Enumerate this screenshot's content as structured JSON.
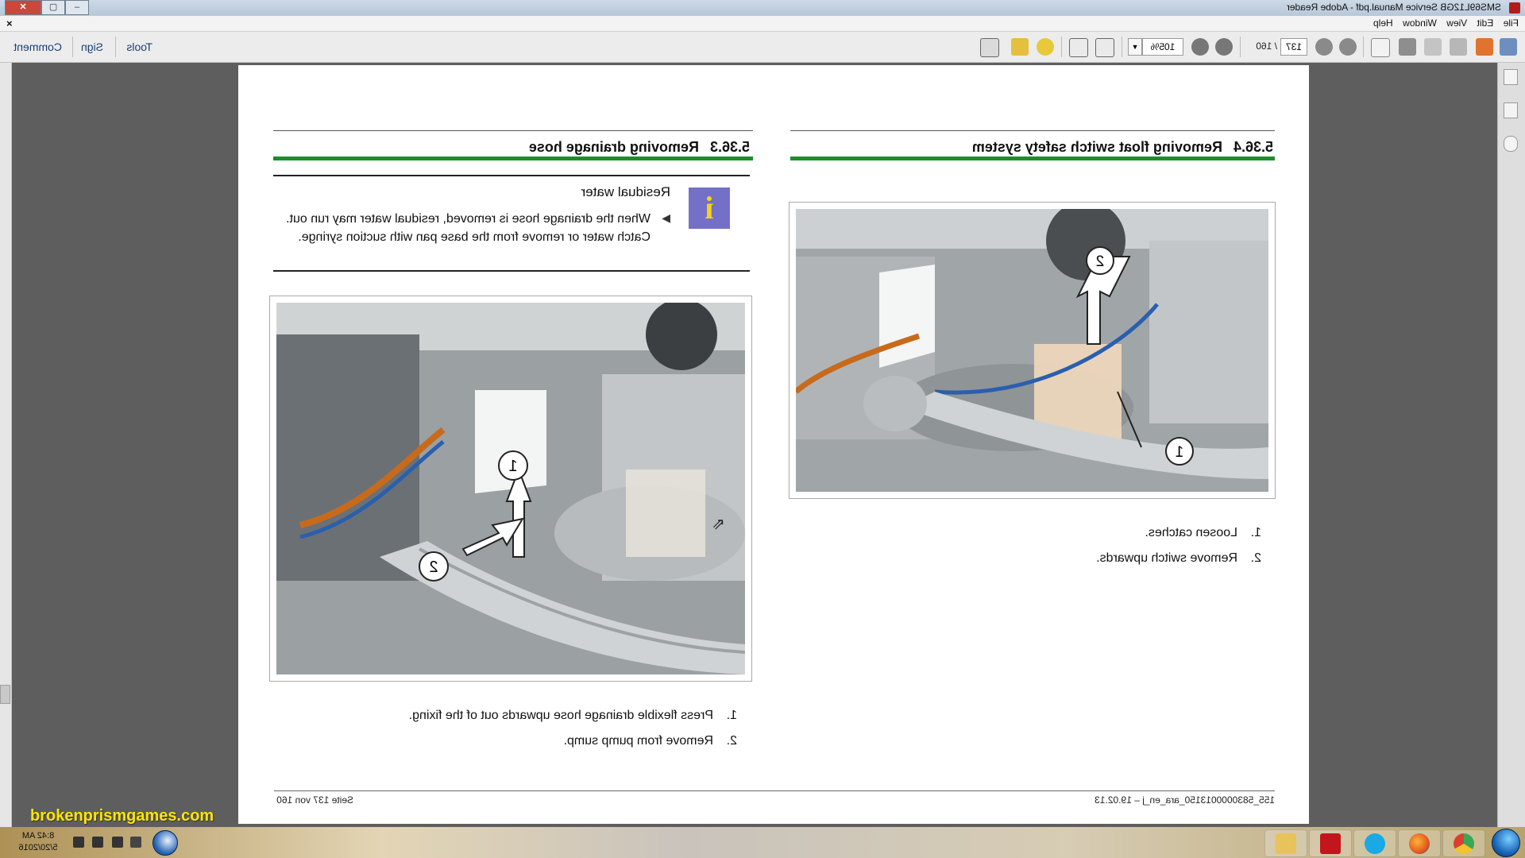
{
  "window": {
    "title": "SMS69L12GB Service Manual.pdf - Adobe Reader",
    "controls": {
      "minimize": "–",
      "maximize": "▢",
      "close": "✕"
    }
  },
  "menu": {
    "items": [
      "File",
      "Edit",
      "View",
      "Window",
      "Help"
    ],
    "close_doc": "×"
  },
  "toolbar": {
    "current_page": "137",
    "page_total": "/ 160",
    "zoom": "105%",
    "zoom_dropdown": "▼",
    "links": [
      "Tools",
      "Sign",
      "Comment"
    ],
    "icons": [
      "create-pdf-icon",
      "edit-pdf-icon",
      "export-icon",
      "save-icon",
      "print-icon",
      "email-icon",
      "prev-page-icon",
      "next-page-icon",
      "zoom-out-icon",
      "zoom-in-icon",
      "fit-width-icon",
      "fit-page-icon",
      "comment-bubble-icon",
      "highlight-icon",
      "fullscreen-icon"
    ]
  },
  "document": {
    "left": {
      "heading_number": "5.36.3",
      "heading": "Removing drainage hose",
      "info_title": "Residual water",
      "info_text": "When the drainage hose is removed, residual water may run out. Catch water or remove from the base pan with suction syringe.",
      "steps": [
        {
          "num": "1.",
          "text": "Press flexible drainage hose upwards out of the fixing."
        },
        {
          "num": "2.",
          "text": "Remove from pump sump."
        }
      ],
      "callouts": [
        "1",
        "2"
      ]
    },
    "right": {
      "heading_number": "5.36.4",
      "heading": "Removing float switch safety system",
      "steps": [
        {
          "num": "1.",
          "text": "Loosen catches."
        },
        {
          "num": "2.",
          "text": "Remove switch upwards."
        }
      ],
      "callouts": [
        "1",
        "2"
      ]
    },
    "footer_left": "155_5830000013150_ara_en_j – 19.02.13",
    "footer_right": "Seite 137 von 160"
  },
  "taskbar": {
    "time": "8:42 AM",
    "date": "5/20/2016",
    "apps": [
      "explorer-icon",
      "acrobat-icon",
      "skype-icon",
      "firefox-icon",
      "chrome-icon"
    ]
  },
  "watermark": "brokenprismgames.com",
  "colors": {
    "heading_bar": "#1c8e2c",
    "info_icon": "#7470c8",
    "info_letter": "#f5d417"
  }
}
